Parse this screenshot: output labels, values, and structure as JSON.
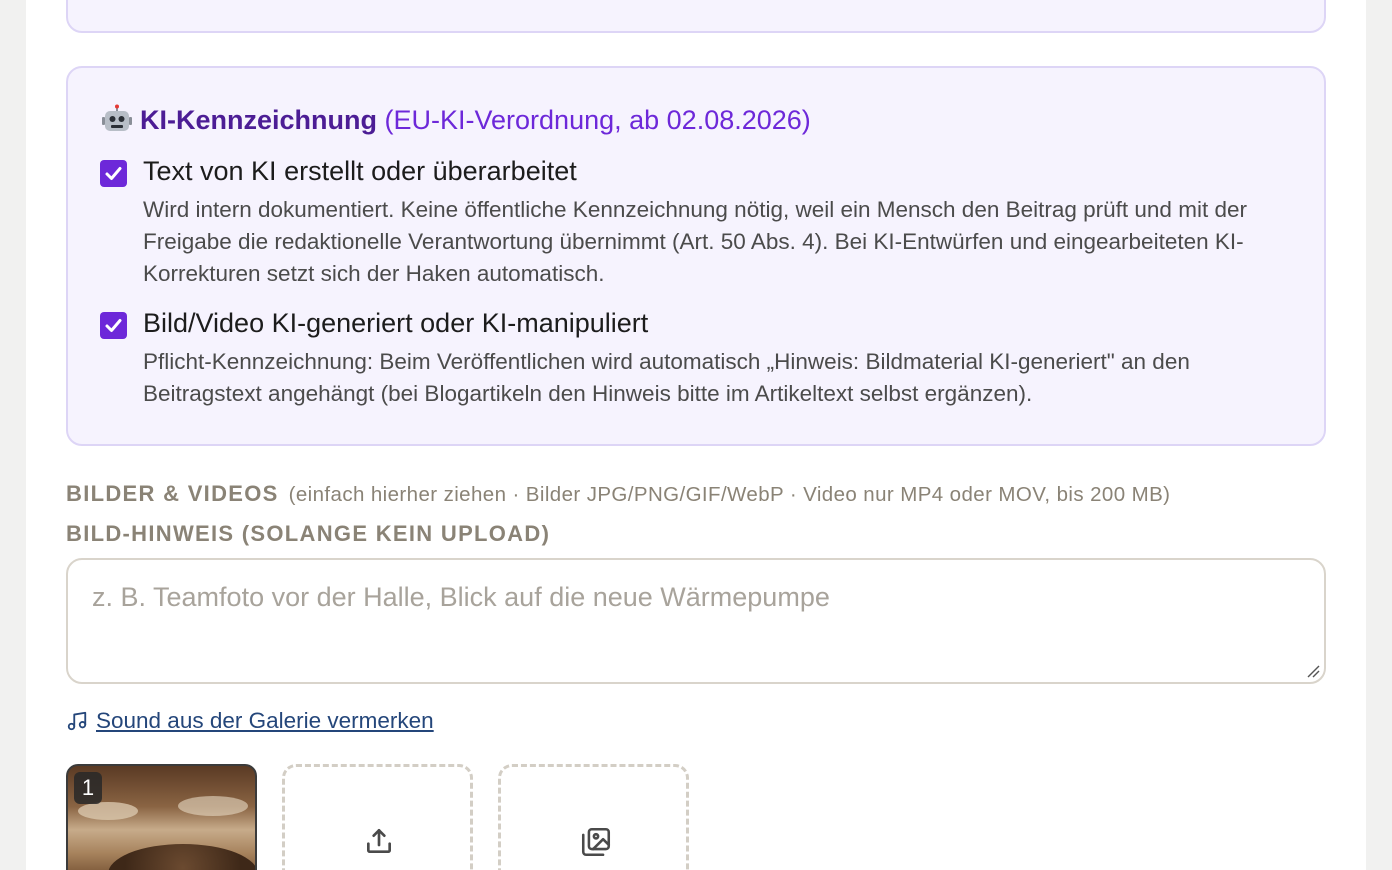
{
  "ai_labeling": {
    "title": "KI-Kennzeichnung",
    "subtitle": "(EU-KI-Verordnung, ab 02.08.2026)",
    "options": [
      {
        "checked": true,
        "label": "Text von KI erstellt oder überarbeitet",
        "description": "Wird intern dokumentiert. Keine öffentliche Kennzeichnung nötig, weil ein Mensch den Beitrag prüft und mit der Freigabe die redaktionelle Verantwortung übernimmt (Art. 50 Abs. 4). Bei KI-Entwürfen und eingearbeiteten KI-Korrekturen setzt sich der Haken automatisch."
      },
      {
        "checked": true,
        "label": "Bild/Video KI-generiert oder KI-manipuliert",
        "description": "Pflicht-Kennzeichnung: Beim Veröffentlichen wird automatisch „Hinweis: Bildmaterial KI-generiert\" an den Beitragstext angehängt (bei Blogartikeln den Hinweis bitte im Artikeltext selbst ergänzen)."
      }
    ]
  },
  "media": {
    "label": "BILDER & VIDEOS",
    "hint": "(einfach hierher ziehen · Bilder JPG/PNG/GIF/WebP · Video nur MP4 oder MOV, bis 200 MB)"
  },
  "image_note": {
    "label": "BILD-HINWEIS (SOLANGE KEIN UPLOAD)",
    "value": "",
    "placeholder": "z. B. Teamfoto vor der Halle, Blick auf die neue Wärmepumpe"
  },
  "sound": {
    "icon": "music-note-icon",
    "link_label": "Sound aus der Galerie vermerken"
  },
  "thumbnails": [
    {
      "index": "1"
    }
  ],
  "tiles": [
    {
      "icon": "upload-icon"
    },
    {
      "icon": "gallery-icon"
    }
  ],
  "colors": {
    "accent": "#6d28d9",
    "title": "#4c1d95",
    "box_bg": "#f6f3fe",
    "box_border": "#ddd5f6",
    "link": "#24467a",
    "muted_label": "#8a8376"
  }
}
